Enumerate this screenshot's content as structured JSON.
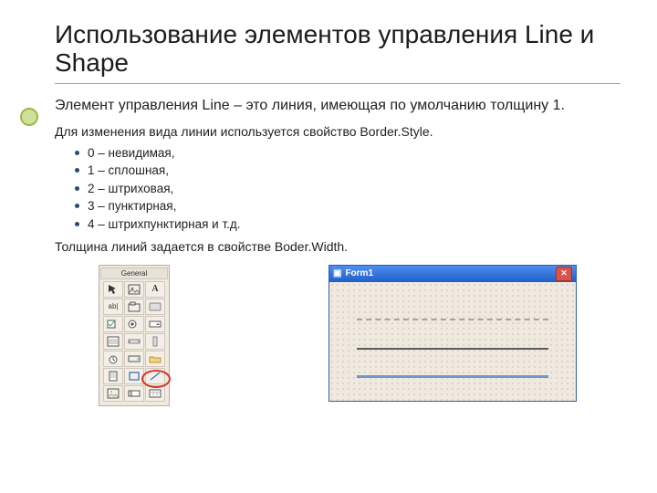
{
  "title": "Использование элементов управления Line и Shape",
  "lead": "Элемент управления Line – это линия, имеющая по умолчанию толщину 1.",
  "para_style": "Для изменения вида  линии используется свойство Border.Style.",
  "options": [
    "0 – невидимая,",
    "1 – сплошная,",
    "2 – штриховая,",
    "3 – пунктирная,",
    "4 – штрихпунктирная и т.д."
  ],
  "para_width": "Толщина линий задается  в свойстве Boder.Width.",
  "toolbox": {
    "title": "General"
  },
  "formwin": {
    "title": "Form1",
    "close": "✕"
  }
}
